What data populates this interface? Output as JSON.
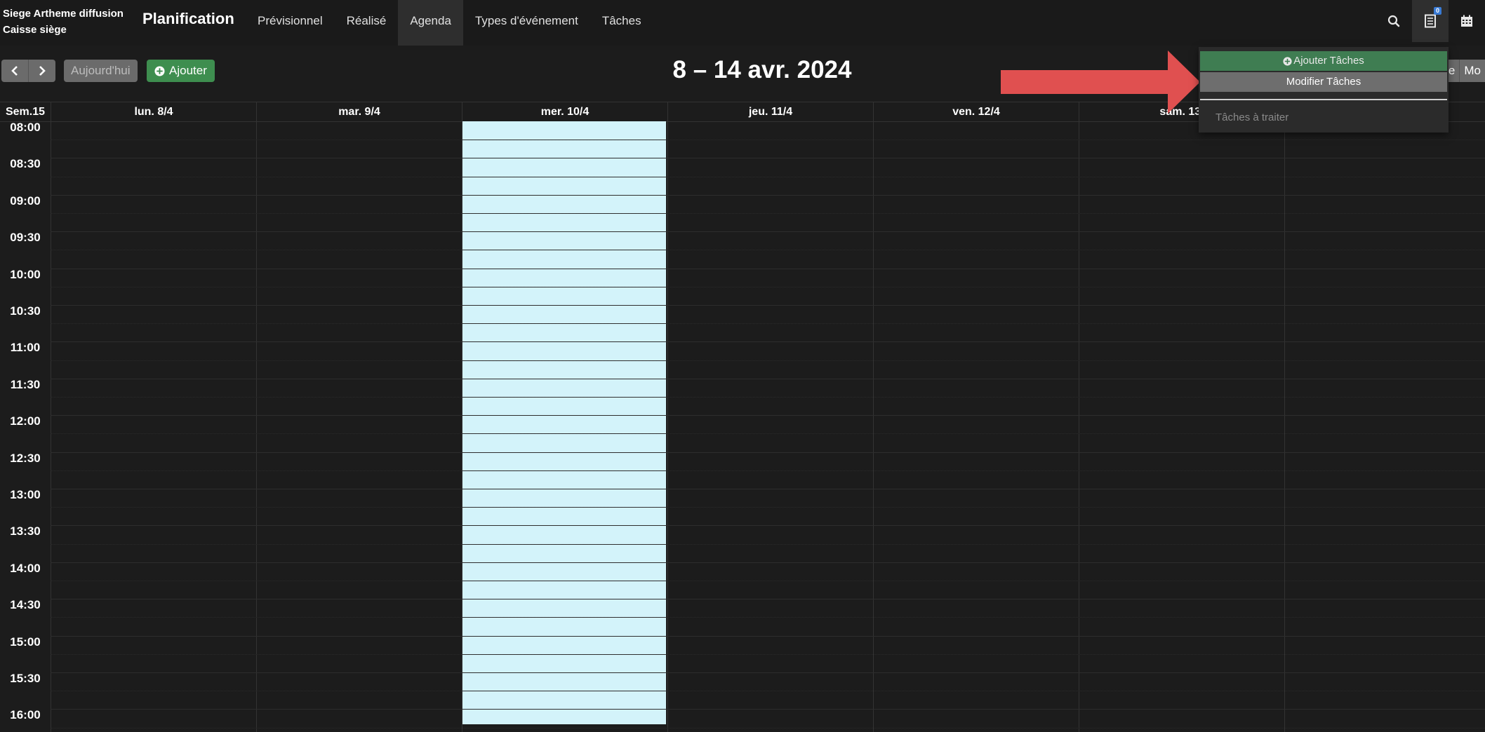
{
  "header": {
    "org_line1": "Siege Artheme diffusion",
    "org_line2": "Caisse siège",
    "app_title": "Planification",
    "nav": [
      {
        "label": "Prévisionnel"
      },
      {
        "label": "Réalisé"
      },
      {
        "label": "Agenda",
        "active": true
      },
      {
        "label": "Types d'événement"
      },
      {
        "label": "Tâches"
      }
    ],
    "tasks_badge": "0",
    "icons": [
      "search-icon",
      "task-list-icon",
      "calendar-icon"
    ]
  },
  "toolbar": {
    "today_label": "Aujourd'hui",
    "add_label": "Ajouter",
    "title": "8 – 14 avr. 2024",
    "view_buttons": [
      "e",
      "Mo"
    ]
  },
  "calendar": {
    "week_label": "Sem.15",
    "days": [
      "lun. 8/4",
      "mar. 9/4",
      "mer. 10/4",
      "jeu. 11/4",
      "ven. 12/4",
      "sam. 13/",
      ""
    ],
    "today_index": 2,
    "times": [
      "08:00",
      "08:30",
      "09:00",
      "09:30",
      "10:00",
      "10:30",
      "11:00",
      "11:30",
      "12:00",
      "12:30",
      "13:00",
      "13:30",
      "14:00",
      "14:30",
      "15:00",
      "15:30",
      "16:00"
    ],
    "today_color": "#d3f3fa"
  },
  "dropdown": {
    "add_tasks": "Ajouter Tâches",
    "edit_tasks": "Modifier Tâches",
    "pending_tasks": "Tâches à traiter"
  },
  "colors": {
    "background": "#1c1c1c",
    "success": "#3e8e4f",
    "arrow": "#e05050"
  }
}
